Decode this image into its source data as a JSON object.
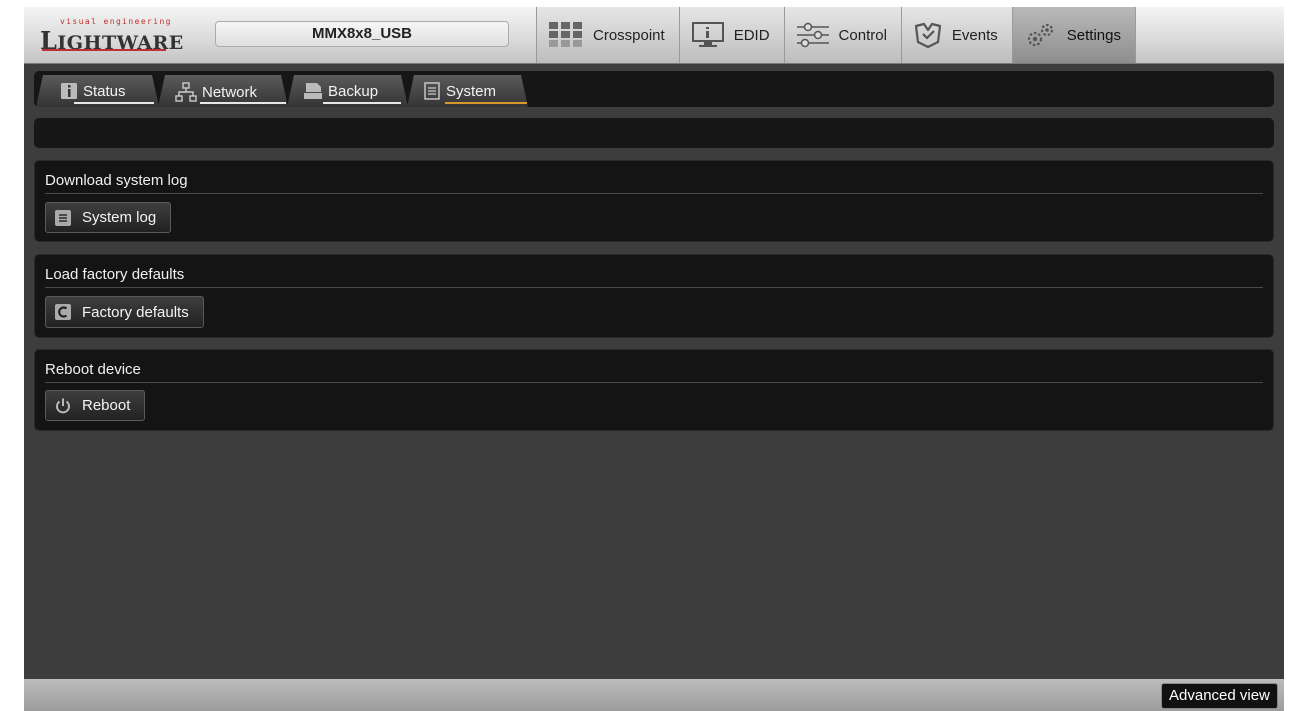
{
  "brand": {
    "tagline": "visual engineering",
    "logo_text": "LIGHTWARE",
    "logo_first": "L",
    "logo_rest": "IGHTWARE",
    "accent": "#c03030"
  },
  "device": {
    "name": "MMX8x8_USB"
  },
  "nav": {
    "items": [
      {
        "label": "Crosspoint",
        "icon": "crosspoint-grid-icon"
      },
      {
        "label": "EDID",
        "icon": "monitor-icon"
      },
      {
        "label": "Control",
        "icon": "sliders-icon"
      },
      {
        "label": "Events",
        "icon": "events-icon"
      },
      {
        "label": "Settings",
        "icon": "gears-icon",
        "active": true
      }
    ]
  },
  "subtabs": [
    {
      "label": "Status",
      "icon": "info-icon"
    },
    {
      "label": "Network",
      "icon": "network-icon"
    },
    {
      "label": "Backup",
      "icon": "backup-icon"
    },
    {
      "label": "System",
      "icon": "document-icon",
      "active": true
    }
  ],
  "sections": {
    "log": {
      "title": "Download system log",
      "button": "System log",
      "icon": "document-icon"
    },
    "factory": {
      "title": "Load factory defaults",
      "button": "Factory defaults",
      "icon": "reset-icon"
    },
    "reboot": {
      "title": "Reboot device",
      "button": "Reboot",
      "icon": "power-icon"
    }
  },
  "footer": {
    "advanced_view": "Advanced view"
  },
  "colors": {
    "active_tab_underline": "#d69a2a",
    "panel": "#141414",
    "background": "#3d3d3d"
  }
}
